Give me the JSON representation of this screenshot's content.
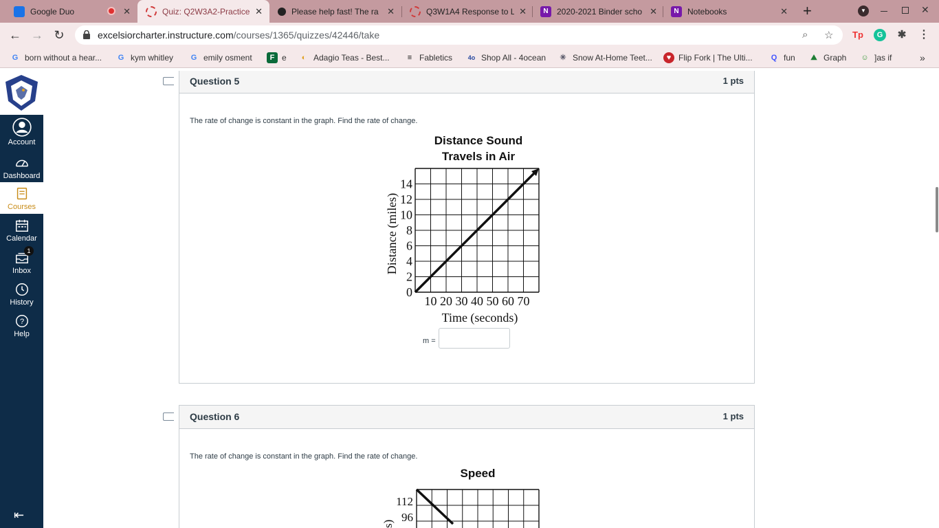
{
  "browser": {
    "tabs": [
      {
        "title": "Google Duo",
        "icon_color": "#1a73e8"
      },
      {
        "title": "Quiz: Q2W3A2-Practice",
        "icon_color": "#d03b3b",
        "active": true
      },
      {
        "title": "Please help fast! The ra",
        "icon_color": "#222222"
      },
      {
        "title": "Q3W1A4 Response to L",
        "icon_color": "#d03b3b"
      },
      {
        "title": "2020-2021 Binder scho",
        "icon_color": "#7719aa"
      },
      {
        "title": "Notebooks",
        "icon_color": "#7719aa"
      }
    ],
    "new_tab_label": "+",
    "url_host": "excelsiorcharter.instructure.com",
    "url_path": "/courses/1365/quizzes/42446/take",
    "bookmarks": [
      {
        "label": "born without a hear...",
        "icon": "google-icon"
      },
      {
        "label": "kym whitley",
        "icon": "google-icon"
      },
      {
        "label": "emily osment",
        "icon": "google-icon"
      },
      {
        "label": "e",
        "icon": "forms-icon"
      },
      {
        "label": "Adagio Teas - Best...",
        "icon": "adagio-icon"
      },
      {
        "label": "Fabletics",
        "icon": "fabletics-icon"
      },
      {
        "label": "Shop All - 4ocean",
        "icon": "ocean-icon"
      },
      {
        "label": "Snow At-Home Teet...",
        "icon": "snow-icon"
      },
      {
        "label": "Flip Fork | The Ulti...",
        "icon": "flipfork-icon"
      },
      {
        "label": "fun",
        "icon": "quizlet-icon"
      },
      {
        "label": "Graph",
        "icon": "graph-icon"
      },
      {
        "label": "]as if",
        "icon": "person-icon"
      }
    ],
    "more_bookmarks": "»"
  },
  "nav": {
    "items": [
      {
        "label": "Account",
        "icon": "account-icon"
      },
      {
        "label": "Dashboard",
        "icon": "dashboard-icon"
      },
      {
        "label": "Courses",
        "icon": "courses-icon",
        "active": true
      },
      {
        "label": "Calendar",
        "icon": "calendar-icon"
      },
      {
        "label": "Inbox",
        "icon": "inbox-icon",
        "badge": "1"
      },
      {
        "label": "History",
        "icon": "history-icon"
      },
      {
        "label": "Help",
        "icon": "help-icon"
      }
    ],
    "accent_color": "#c88c18",
    "background": "#0e2c48"
  },
  "questions": [
    {
      "name": "Question 5",
      "points": "1 pts",
      "text": "The rate of change is constant in the graph. Find the rate of change.",
      "answer_label": "m =",
      "answer_value": "",
      "chart_data": {
        "type": "line",
        "title": "Distance Sound Travels in Air",
        "title_lines": [
          "Distance Sound",
          "Travels in Air"
        ],
        "xlabel": "Time (seconds)",
        "ylabel": "Distance (miles)",
        "x_ticks": [
          "10",
          "20",
          "30",
          "40",
          "50",
          "60",
          "70"
        ],
        "y_ticks": [
          "0",
          "2",
          "4",
          "6",
          "8",
          "10",
          "12",
          "14"
        ],
        "xlim": [
          0,
          80
        ],
        "ylim": [
          0,
          16
        ],
        "grid": true,
        "series": [
          {
            "x": [
              0,
              80
            ],
            "y": [
              0,
              16
            ]
          }
        ]
      }
    },
    {
      "name": "Question 6",
      "points": "1 pts",
      "text": "The rate of change is constant in the graph. Find the rate of change.",
      "chart_data": {
        "type": "line",
        "title": "Speed",
        "y_ticks": [
          "112",
          "96"
        ],
        "grid": true
      }
    }
  ]
}
